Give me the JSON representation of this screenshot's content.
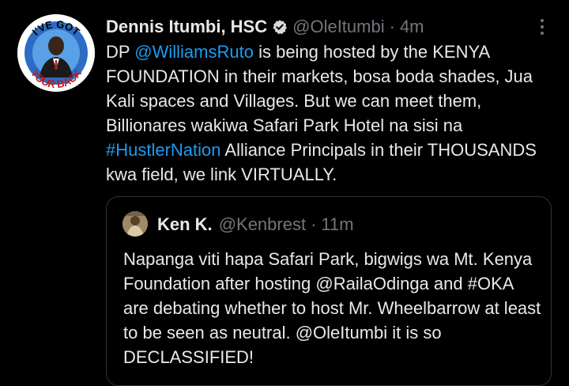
{
  "tweet": {
    "author_name": "Dennis Itumbi, HSC",
    "author_handle": "@OleItumbi",
    "separator": "·",
    "time": "4m",
    "text_parts": [
      "DP ",
      "@WilliamsRuto",
      " is being hosted by the KENYA FOUNDATION in their markets, bosa boda shades, Jua Kali spaces and Villages. But we can meet them, Billionares wakiwa Safari Park Hotel na sisi na ",
      "#HustlerNation",
      " Alliance Principals in their THOUSANDS kwa field, we link VIRTUALLY."
    ],
    "avatar_text": "I'VE GOT YOUR BACK"
  },
  "quoted": {
    "author_name": "Ken K.",
    "author_handle": "@Kenbrest",
    "separator": "·",
    "time": "11m",
    "text": "Napanga viti hapa Safari Park, bigwigs wa Mt. Kenya Foundation after hosting @RailaOdinga and #OKA are debating whether to host Mr. Wheelbarrow at least to be seen as neutral. @OleItumbi it is so DECLASSIFIED!"
  },
  "colors": {
    "background": "#000000",
    "text": "#e7e9ea",
    "muted": "#71767b",
    "link": "#1d9bf0",
    "border": "#2f3336",
    "verified_badge": "#d9d9d9"
  },
  "icons": {
    "verified": "verified-badge-icon",
    "more": "more-options-icon"
  }
}
